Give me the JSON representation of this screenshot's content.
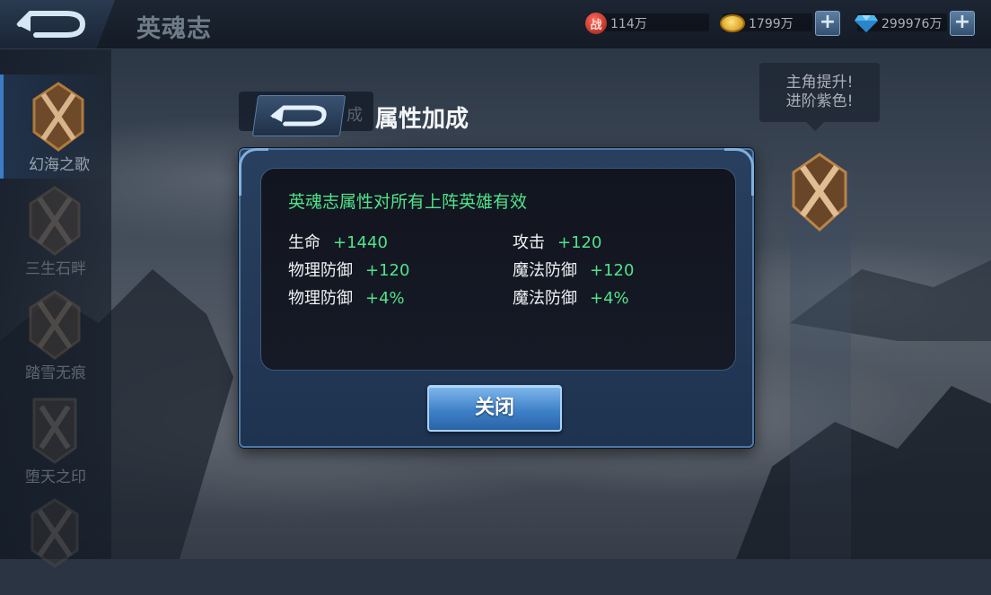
{
  "topbar": {
    "title": "英魂志",
    "power_icon_text": "战",
    "power_value": "114万",
    "gold_value": "1799万",
    "diamond_value": "299976万",
    "icons": [
      "back-arrow-icon",
      "power-icon",
      "gold-coin-icon",
      "diamond-icon",
      "plus-icon"
    ]
  },
  "sidebar": {
    "items": [
      {
        "label": "幻海之歌",
        "active": true
      },
      {
        "label": "三生石畔",
        "active": false
      },
      {
        "label": "踏雪无痕",
        "active": false
      },
      {
        "label": "堕天之印",
        "active": false
      },
      {
        "label": "",
        "active": false
      }
    ]
  },
  "right_panel": {
    "tip_line1": "主角提升!",
    "tip_line2": "进阶紫色!"
  },
  "dialog": {
    "tab_ghost": "成",
    "title": "属性加成",
    "effect_text": "英魂志属性对所有上阵英雄有效",
    "stats": [
      {
        "name": "生命",
        "value": "+1440"
      },
      {
        "name": "攻击",
        "value": "+120"
      },
      {
        "name": "物理防御",
        "value": "+120"
      },
      {
        "name": "魔法防御",
        "value": "+120"
      },
      {
        "name": "物理防御",
        "value": "+4%"
      },
      {
        "name": "魔法防御",
        "value": "+4%"
      }
    ],
    "close_label": "关闭"
  },
  "colors": {
    "accent_green": "#4fe38a",
    "button_blue": "#3f82c9",
    "panel_border": "#4f78a6"
  }
}
